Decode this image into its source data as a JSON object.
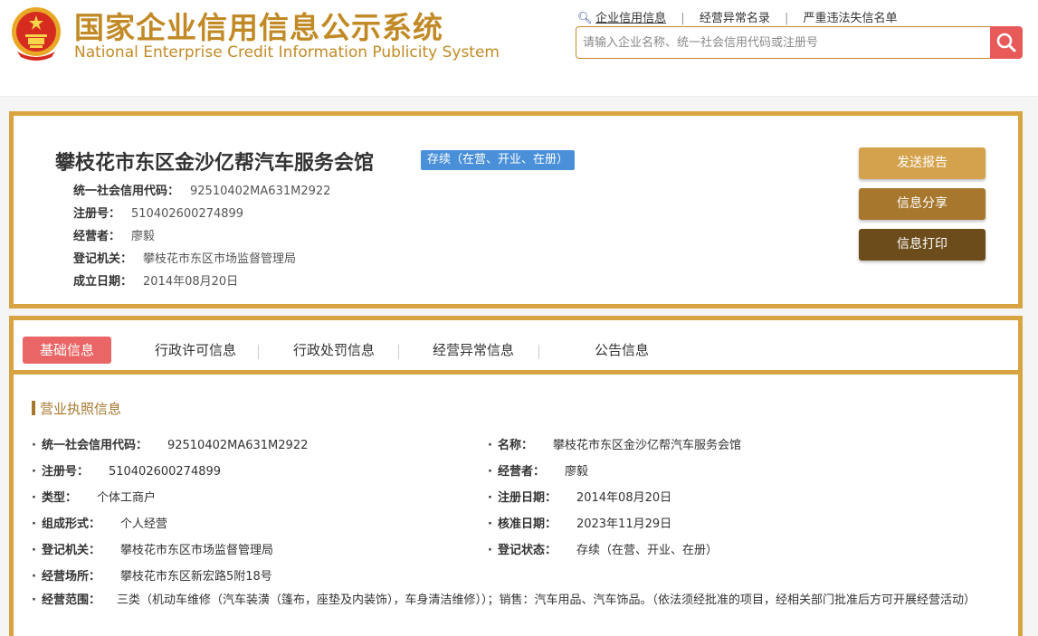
{
  "header": {
    "title_cn": "国家企业信用信息公示系统",
    "title_en": "National Enterprise Credit Information Publicity System",
    "nav": [
      "企业信用信息",
      "经营异常名录",
      "严重违法失信名单"
    ],
    "search_placeholder": "请输入企业名称、统一社会信用代码或注册号"
  },
  "company": {
    "name": "攀枝花市东区金沙亿帮汽车服务会馆",
    "status": "存续（在营、开业、在册）",
    "rows": [
      {
        "label": "统一社会信用代码：",
        "value": "92510402MA631M2922"
      },
      {
        "label": "注册号：",
        "value": "510402600274899"
      },
      {
        "label": "经营者：",
        "value": "廖毅"
      },
      {
        "label": "登记机关：",
        "value": "攀枝花市东区市场监督管理局"
      },
      {
        "label": "成立日期：",
        "value": "2014年08月20日"
      }
    ],
    "buttons": {
      "report": "发送报告",
      "share": "信息分享",
      "print": "信息打印"
    }
  },
  "tabs": [
    "基础信息",
    "行政许可信息",
    "行政处罚信息",
    "经营异常信息",
    "公告信息"
  ],
  "license": {
    "section_title": "营业执照信息",
    "left": [
      {
        "label": "统一社会信用代码：",
        "value": "92510402MA631M2922"
      },
      {
        "label": "注册号：",
        "value": "510402600274899"
      },
      {
        "label": "类型：",
        "value": "个体工商户"
      },
      {
        "label": "组成形式：",
        "value": "个人经营"
      },
      {
        "label": "登记机关：",
        "value": "攀枝花市东区市场监督管理局"
      },
      {
        "label": "经营场所：",
        "value": "攀枝花市东区新宏路5附18号"
      }
    ],
    "right": [
      {
        "label": "名称：",
        "value": "攀枝花市东区金沙亿帮汽车服务会馆"
      },
      {
        "label": "经营者：",
        "value": "廖毅"
      },
      {
        "label": "注册日期：",
        "value": "2014年08月20日"
      },
      {
        "label": "核准日期：",
        "value": "2023年11月29日"
      },
      {
        "label": "登记状态：",
        "value": "存续（在营、开业、在册）"
      }
    ],
    "scope_label": "经营范围：",
    "scope_value": "三类（机动车维修（汽车装潢（篷布，座垫及内装饰），车身清洁维修））；销售：汽车用品、汽车饰品。（依法须经批准的项目，经相关部门批准后方可开展经营活动）"
  }
}
